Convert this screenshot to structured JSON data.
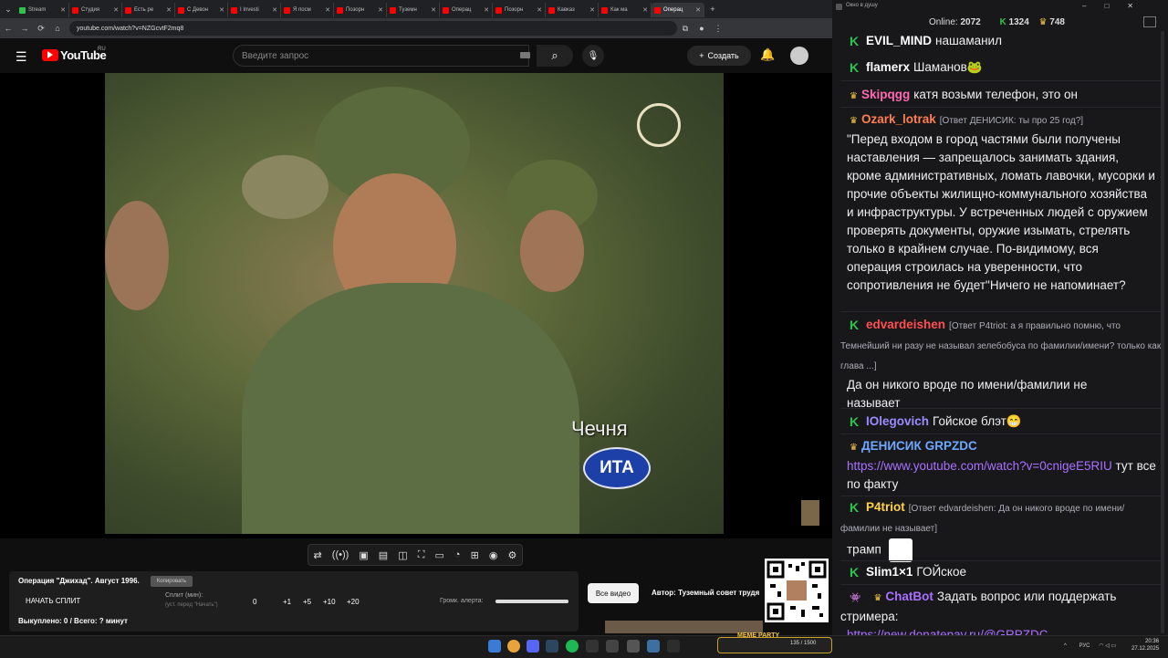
{
  "browser": {
    "tabs": [
      {
        "label": "Stream",
        "color": "#2ec44b"
      },
      {
        "label": "Студия",
        "color": "#ff0000"
      },
      {
        "label": "Есть ре",
        "color": "#ff0000"
      },
      {
        "label": "С Девон",
        "color": "#ff0000"
      },
      {
        "label": "I Investi",
        "color": "#ff0000"
      },
      {
        "label": "Я посм",
        "color": "#ff0000"
      },
      {
        "label": "Позорн",
        "color": "#ff0000"
      },
      {
        "label": "Туземн",
        "color": "#ff0000"
      },
      {
        "label": "Операц",
        "color": "#ff0000"
      },
      {
        "label": "Позорн",
        "color": "#ff0000"
      },
      {
        "label": "Кавказ",
        "color": "#ff0000"
      },
      {
        "label": "Как ма",
        "color": "#ff0000"
      },
      {
        "label": "Операц",
        "color": "#ff0000",
        "active": true
      }
    ],
    "url": "youtube.com/watch?v=NZGcvtF2mq8"
  },
  "youtube": {
    "logo": "YouTube",
    "region": "RU",
    "search_placeholder": "Введите запрос",
    "create_label": "Создать"
  },
  "video": {
    "overlay_place": "Чечня",
    "overlay_logo": "ИТА"
  },
  "panel": {
    "title": "Операция \"Джихад\". Август 1996.",
    "copy_label": "Копировать",
    "split_button": "НАЧАТЬ СПЛИТ",
    "split_label": "Сплит (мин):",
    "split_hint": "(уст. перед \"Начать\")",
    "split_value": "0",
    "steps": [
      "+1",
      "+5",
      "+10",
      "+20"
    ],
    "alert_label": "Громк. алерта:",
    "alert_level": 1.0,
    "bought": "Выкуплено: 0 / Всего: ? минут",
    "all_video": "Все видео",
    "author": "Автор: Туземный совет трудя"
  },
  "chat": {
    "window_title": "Окно в душу",
    "online_label": "Online:",
    "online": "2072",
    "k_count": "1324",
    "crown_count": "748",
    "messages": [
      {
        "badge": "k",
        "user": "EVIL_MIND",
        "color": "#ffffff",
        "text": "нашаманил"
      },
      {
        "badge": "k",
        "user": "flamerx",
        "color": "#ffffff",
        "text": "Шаманов🐸"
      },
      {
        "badge": "crown",
        "user": "Skipqgg",
        "color": "#ff69b4",
        "text": "катя возьми телефон, это он"
      },
      {
        "badge": "crown",
        "user": "Ozark_lotrak",
        "color": "#ff7f50",
        "reply": "[Ответ ДЕНИСИК: ты про 25 год?]",
        "text": "\"Перед входом в город частями были получены наставления — запрещалось занимать здания, кроме административных, ломать лавочки, мусорки и прочие объекты жилищно-коммунального хозяйства и инфраструктуры. У встреченных людей с оружием проверять документы, оружие изымать, стрелять только в крайнем случае. По-видимому, вся операция строилась на уверенности, что сопротивления не будет\"Ничего не напоминает?"
      },
      {
        "badge": "k",
        "user": "edvardeishen",
        "color": "#ff4f4f",
        "reply": "[Ответ P4triot: а я правильно помню, что Темнейший ни разу не называл зелебобуса по фамилии/имени? только как глава ...]",
        "text": "Да он никого вроде по имени/фамилии не называет"
      },
      {
        "badge": "k",
        "user": "IOlegovich",
        "color": "#9b8cff",
        "text": "Гойское блэт😁"
      },
      {
        "badge": "crown",
        "user": "ДЕНИСИК",
        "color": "#6fa8ff",
        "text_prefix": "GRPZDC",
        "link": "https://www.youtube.com/watch?v=0cnigeE5RIU",
        "text": "тут все по факту"
      },
      {
        "badge": "k",
        "user": "P4triot",
        "color": "#ffd24a",
        "reply": "[Ответ edvardeishen: Да он никого вроде по имени/фамилии не называет]",
        "text": "трамп"
      },
      {
        "badge": "k",
        "user": "Slim1×1",
        "color": "#ffffff",
        "text": "ГОЙское"
      },
      {
        "badge": "bot",
        "user": "ChatBot",
        "color": "#a970ff",
        "text": "Задать вопрос или поддержать стримера:",
        "link": "https://new.donatepay.ru/@GRPZDC"
      }
    ]
  },
  "taskbar": {
    "lang": "РУС",
    "time": "20:36",
    "date": "27.12.2025",
    "meme_party": "MEME PARTY",
    "meme_counter": "135 / 1500"
  }
}
